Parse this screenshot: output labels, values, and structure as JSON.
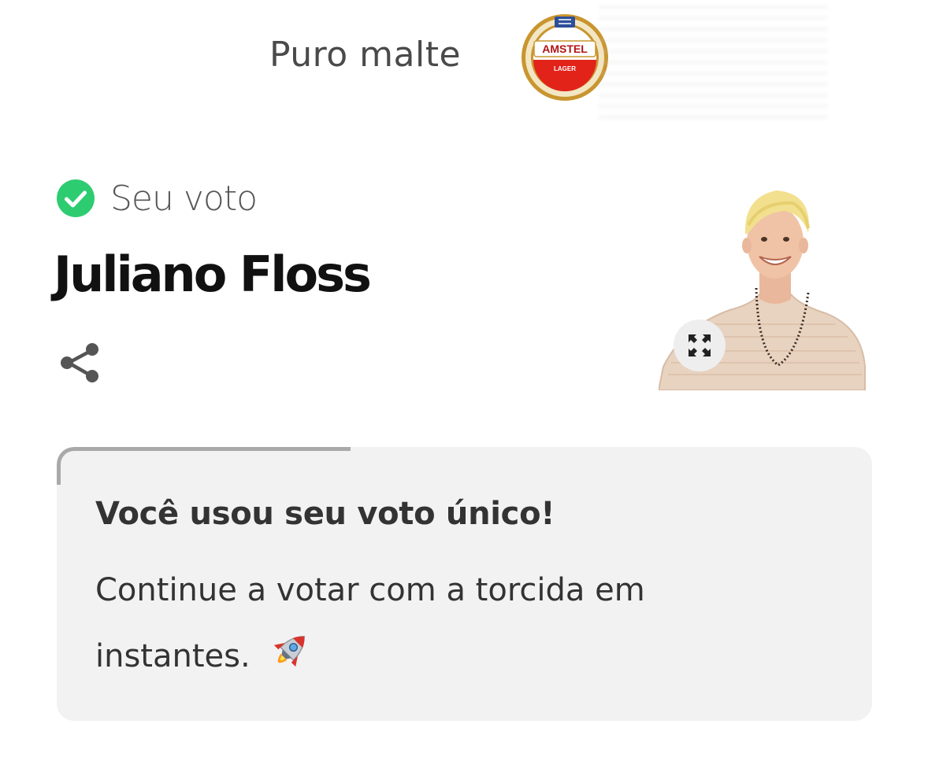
{
  "sponsor": {
    "tagline": "Puro malte",
    "logo_icon": "amstel-lager-logo",
    "logo_text_top": "AMSTEL",
    "logo_text_bottom": "LAGER"
  },
  "vote": {
    "status_icon": "check-circle-icon",
    "status_color": "#2ecc71",
    "label": "Seu voto",
    "candidate_name": "Juliano Floss",
    "share_icon": "share-icon",
    "expand_icon": "expand-icon"
  },
  "notice": {
    "title": "Você usou seu voto único!",
    "body": "Continue a votar com a torcida em instantes.",
    "emoji_icon": "rocket-icon",
    "progress": 0.36
  }
}
